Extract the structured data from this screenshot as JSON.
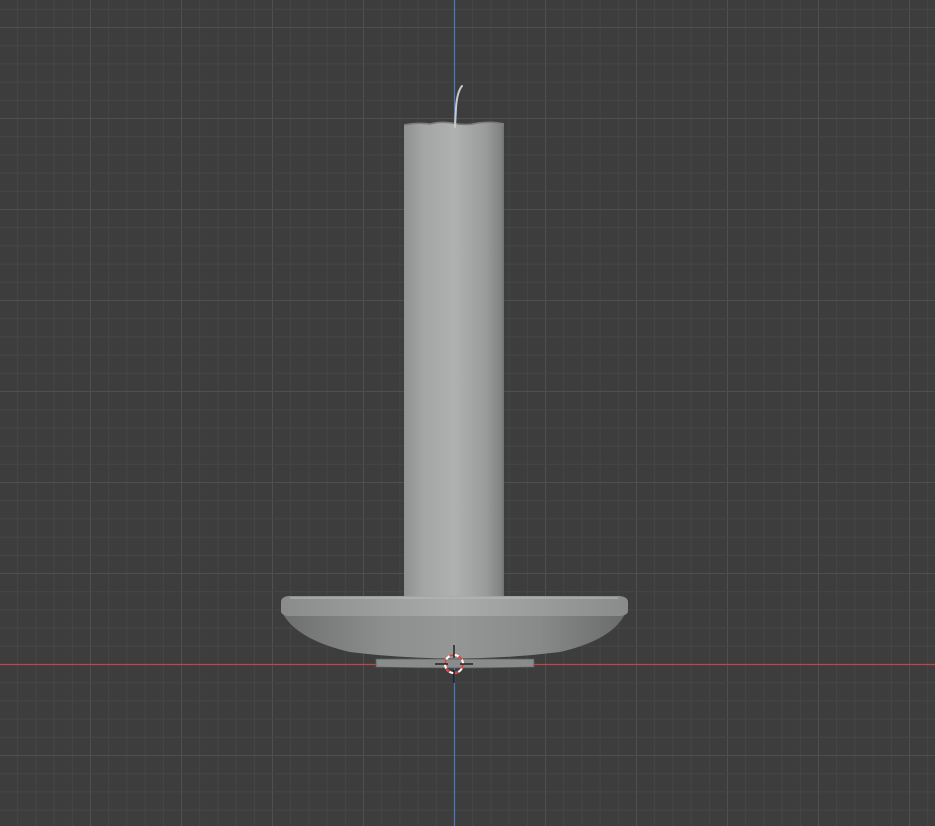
{
  "viewport": {
    "view": "front-orthographic",
    "background_color": "#3d3d3d",
    "grid_minor_color": "#474747",
    "grid_major_color": "#4f4f4f",
    "x_axis_color": "#c8404a",
    "z_axis_color": "#4a78c4",
    "cursor_ring_colors": [
      "#e03a3a",
      "#ffffff"
    ]
  },
  "scene_objects": [
    {
      "name": "candle",
      "icon": "candle-mesh",
      "color": "#a6a8a7"
    },
    {
      "name": "wick",
      "icon": "wick-mesh",
      "color": "#c9c9c9"
    },
    {
      "name": "candle-holder",
      "icon": "dish-mesh",
      "color": "#8e8f8f"
    }
  ],
  "cursor": {
    "icon": "3d-cursor-icon"
  }
}
